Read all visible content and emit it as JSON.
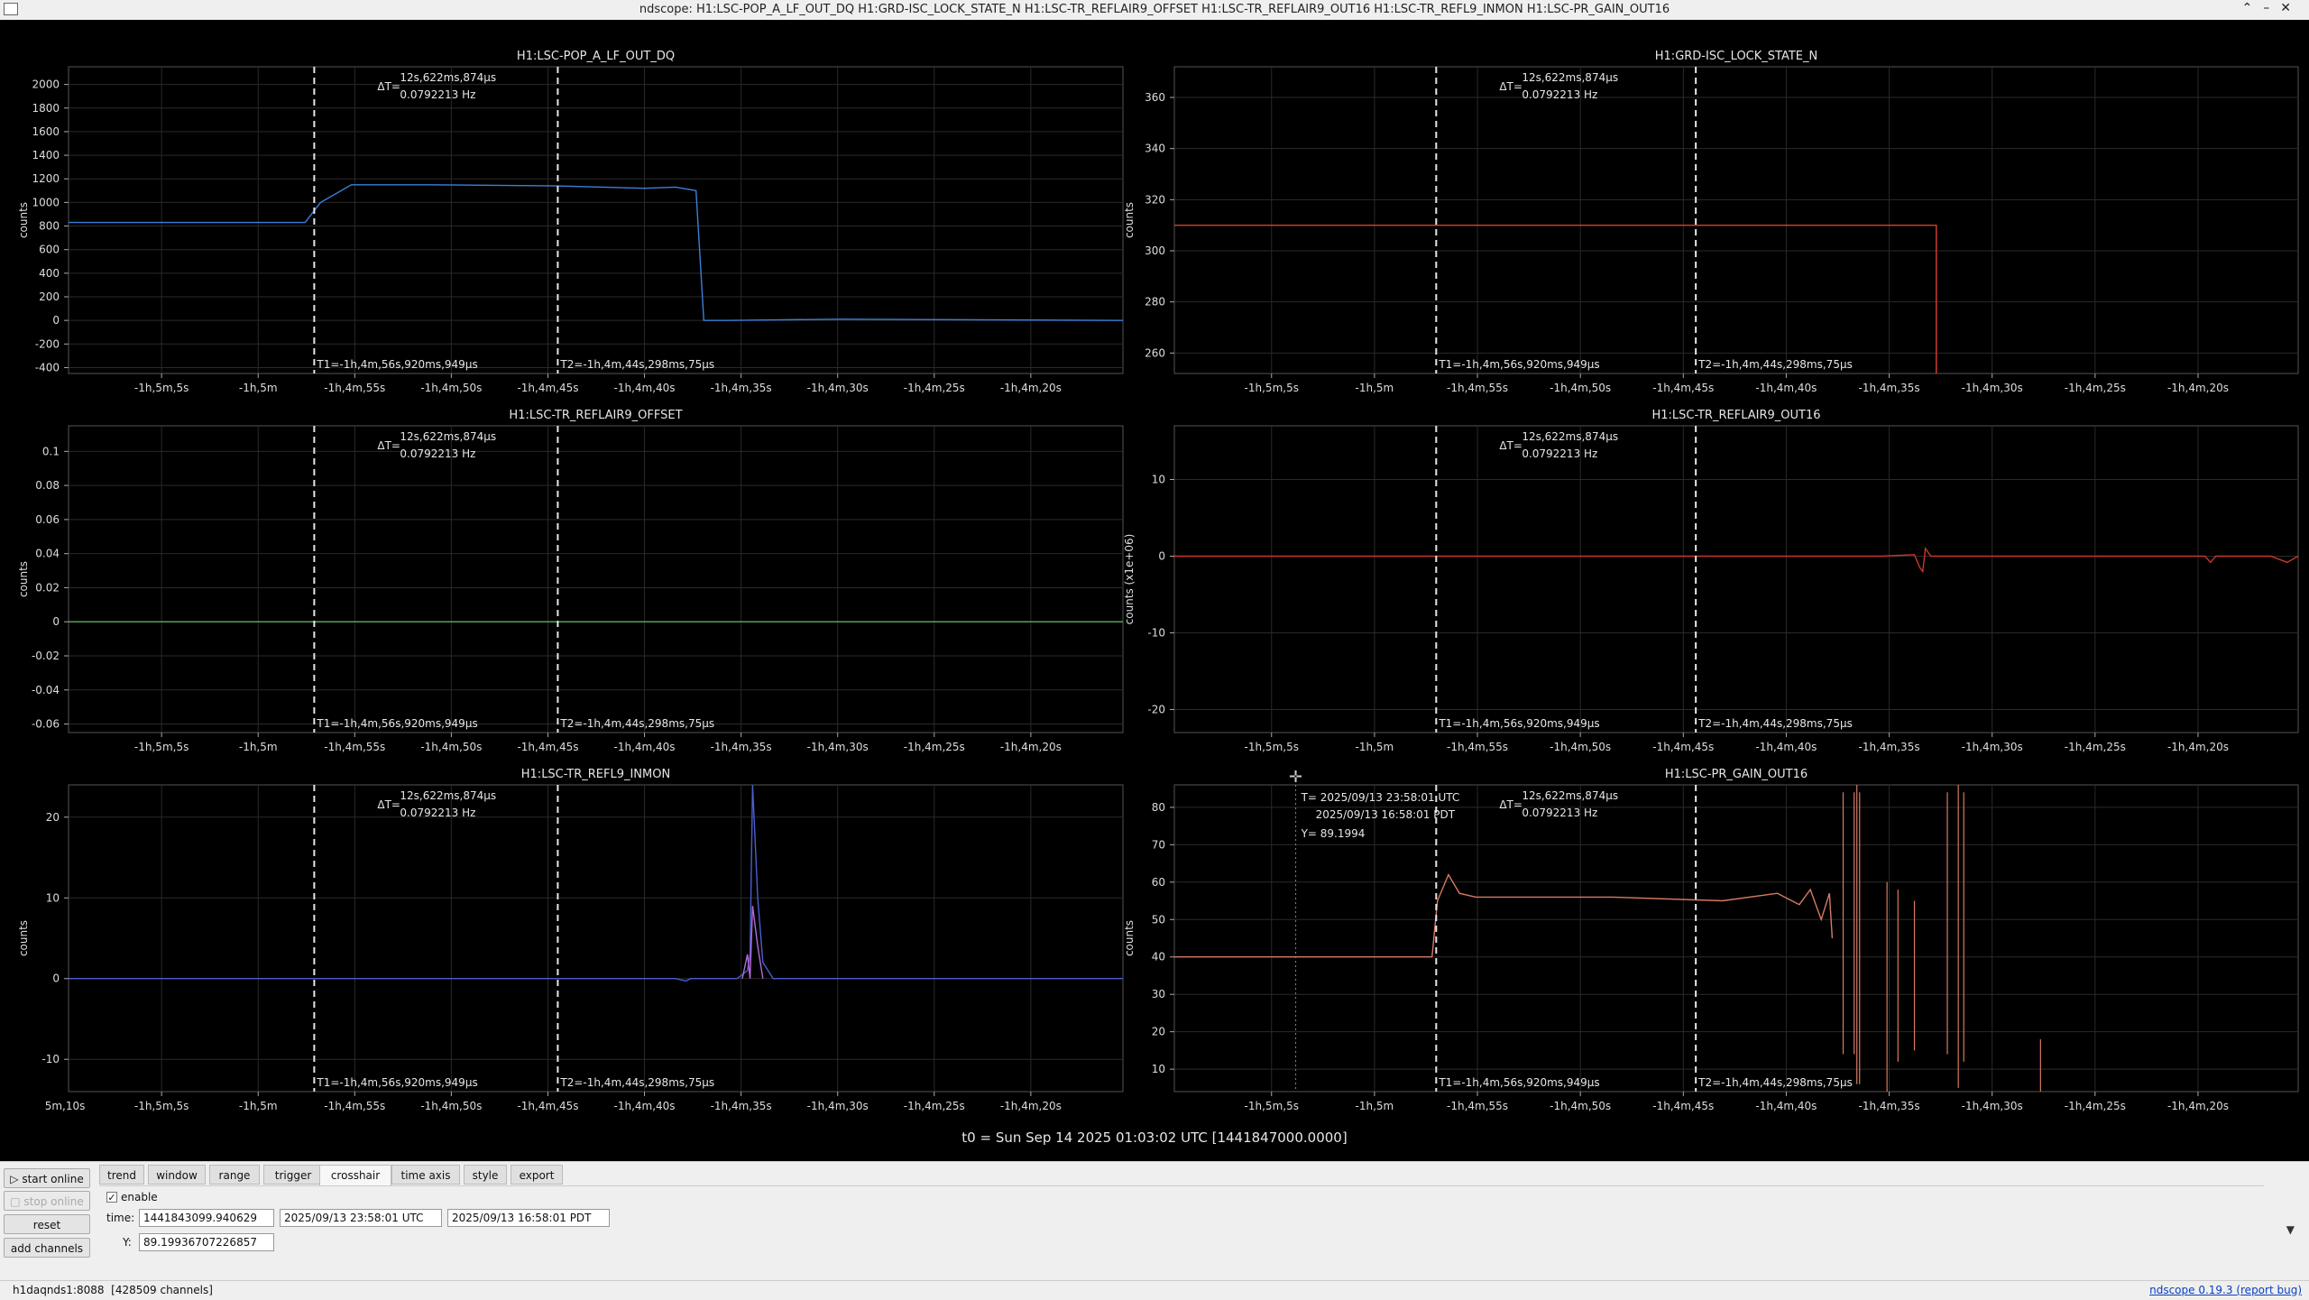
{
  "window": {
    "title": "ndscope: H1:LSC-POP_A_LF_OUT_DQ H1:GRD-ISC_LOCK_STATE_N H1:LSC-TR_REFLAIR9_OFFSET H1:LSC-TR_REFLAIR9_OUT16 H1:LSC-TR_REFL9_INMON H1:LSC-PR_GAIN_OUT16",
    "buttons": [
      "minimize",
      "maximize",
      "close"
    ]
  },
  "cursors": {
    "t1": "T1=-1h,4m,56s,920ms,949μs",
    "t2": "T2=-1h,4m,44s,298ms,75μs",
    "delta_label": "ΔT=",
    "delta_time": "12s,622ms,874μs",
    "delta_freq": "0.0792213 Hz"
  },
  "crosshair_readout": {
    "t_utc": "T= 2025/09/13 23:58:01 UTC",
    "t_pdt": "2025/09/13 16:58:01 PDT",
    "y": "Y= 89.1994"
  },
  "t0_label": "t0 = Sun Sep 14 2025 01:03:02 UTC [1441847000.0000]",
  "chart_data": [
    {
      "type": "line",
      "title": "H1:LSC-POP_A_LF_OUT_DQ",
      "ylabel": "counts",
      "ylim": [
        -450,
        2150
      ],
      "yticks": [
        -400,
        -200,
        0,
        200,
        400,
        600,
        800,
        1000,
        1200,
        1400,
        1600,
        1800,
        2000
      ],
      "xlim": [
        -65.4,
        -63.35
      ],
      "xticks": [
        "-1h,5m,5s",
        "-1h,5m",
        "-1h,4m,55s",
        "-1h,4m,50s",
        "-1h,4m,45s",
        "-1h,4m,40s",
        "-1h,4m,35s",
        "-1h,4m,30s",
        "-1h,4m,25s",
        "-1h,4m,20s"
      ],
      "series": [
        {
          "color": "#3d7fd8",
          "x": [
            -65.4,
            -64.94,
            -64.91,
            -64.85,
            -64.7,
            -64.45,
            -64.28,
            -64.22,
            -64.18,
            -64.165,
            -64.12,
            -63.9,
            -63.35
          ],
          "y": [
            830,
            830,
            1000,
            1150,
            1150,
            1140,
            1120,
            1130,
            1100,
            0,
            0,
            10,
            0
          ]
        }
      ]
    },
    {
      "type": "line",
      "title": "H1:GRD-ISC_LOCK_STATE_N",
      "ylabel": "counts",
      "ylim": [
        252,
        372
      ],
      "yticks": [
        260,
        280,
        300,
        320,
        340,
        360
      ],
      "xlim": [
        -65.4,
        -63.35
      ],
      "xticks": [
        "-1h,5m,5s",
        "-1h,5m",
        "-1h,4m,55s",
        "-1h,4m,50s",
        "-1h,4m,45s",
        "-1h,4m,40s",
        "-1h,4m,35s",
        "-1h,4m,30s",
        "-1h,4m,25s",
        "-1h,4m,20s"
      ],
      "series": [
        {
          "color": "#d9402a",
          "x": [
            -65.4,
            -64.01,
            -64.01
          ],
          "y": [
            310,
            310,
            252
          ]
        }
      ]
    },
    {
      "type": "line",
      "title": "H1:LSC-TR_REFLAIR9_OFFSET",
      "ylabel": "counts",
      "ylim": [
        -0.065,
        0.115
      ],
      "yticks": [
        -0.06,
        -0.04,
        -0.02,
        0,
        0.02,
        0.04,
        0.06,
        0.08,
        0.1
      ],
      "xlim": [
        -65.4,
        -63.35
      ],
      "xticks": [
        "-1h,5m,5s",
        "-1h,5m",
        "-1h,4m,55s",
        "-1h,4m,50s",
        "-1h,4m,45s",
        "-1h,4m,40s",
        "-1h,4m,35s",
        "-1h,4m,30s",
        "-1h,4m,25s",
        "-1h,4m,20s"
      ],
      "series": [
        {
          "color": "#5fae5f",
          "x": [
            -65.4,
            -63.35
          ],
          "y": [
            0,
            0
          ]
        }
      ]
    },
    {
      "type": "line",
      "title": "H1:LSC-TR_REFLAIR9_OUT16",
      "ylabel": "counts (x1e+06)",
      "ylim": [
        -23,
        17
      ],
      "yticks": [
        -20,
        -10,
        0,
        10
      ],
      "xlim": [
        -65.4,
        -63.35
      ],
      "xticks": [
        "-1h,5m,5s",
        "-1h,5m",
        "-1h,4m,55s",
        "-1h,4m,50s",
        "-1h,4m,45s",
        "-1h,4m,40s",
        "-1h,4m,35s",
        "-1h,4m,30s",
        "-1h,4m,25s",
        "-1h,4m,20s"
      ],
      "series": [
        {
          "color": "#c8372a",
          "x": [
            -65.4,
            -64.11,
            -64.05,
            -64.04,
            -64.035,
            -64.03,
            -64.02,
            -63.85,
            -63.52,
            -63.51,
            -63.5,
            -63.4,
            -63.37,
            -63.35
          ],
          "y": [
            0,
            0,
            0.2,
            -1.5,
            -2,
            1,
            0,
            0,
            0,
            -0.8,
            0,
            0,
            -0.8,
            0
          ]
        }
      ]
    },
    {
      "type": "line",
      "title": "H1:LSC-TR_REFL9_INMON",
      "ylabel": "counts",
      "ylim": [
        -14,
        24
      ],
      "yticks": [
        -10,
        0,
        10,
        20
      ],
      "xlim": [
        -65.4,
        -63.35
      ],
      "xticks": [
        "5m,10s",
        "-1h,5m,5s",
        "-1h,5m",
        "-1h,4m,55s",
        "-1h,4m,50s",
        "-1h,4m,45s",
        "-1h,4m,40s",
        "-1h,4m,35s",
        "-1h,4m,30s",
        "-1h,4m,25s",
        "-1h,4m,20s"
      ],
      "series": [
        {
          "color": "#4a5fd0",
          "x": [
            -65.4,
            -64.22,
            -64.2,
            -64.19,
            -64.1,
            -64.08,
            -64.075,
            -64.07,
            -64.06,
            -64.05,
            -64.03,
            -63.35
          ],
          "y": [
            0,
            0,
            -0.3,
            0,
            0,
            1,
            3,
            24,
            10,
            2,
            0,
            0
          ]
        },
        {
          "color": "#b56ad8",
          "x": [
            -64.09,
            -64.08,
            -64.075,
            -64.07,
            -64.06,
            -64.05
          ],
          "y": [
            0,
            3,
            0,
            9,
            4,
            0
          ]
        }
      ]
    },
    {
      "type": "line",
      "title": "H1:LSC-PR_GAIN_OUT16",
      "ylabel": "counts",
      "ylim": [
        4,
        86
      ],
      "yticks": [
        10,
        20,
        30,
        40,
        50,
        60,
        70,
        80
      ],
      "xlim": [
        -65.4,
        -63.35
      ],
      "xticks": [
        "-1h,5m,5s",
        "-1h,5m",
        "-1h,4m,55s",
        "-1h,4m,50s",
        "-1h,4m,45s",
        "-1h,4m,40s",
        "-1h,4m,35s",
        "-1h,4m,30s",
        "-1h,4m,25s",
        "-1h,4m,20s"
      ],
      "series": [
        {
          "color": "#d87a62",
          "x": [
            -65.4,
            -64.93,
            -64.92,
            -64.9,
            -64.88,
            -64.85,
            -64.6,
            -64.4,
            -64.3,
            -64.26,
            -64.24,
            -64.22,
            -64.205,
            -64.2
          ],
          "y": [
            40,
            40,
            55,
            62,
            57,
            56,
            56,
            55,
            57,
            54,
            58,
            50,
            57,
            45
          ]
        }
      ]
    }
  ],
  "tabs": [
    "trend",
    "window",
    "range",
    "trigger",
    "crosshair",
    "time axis",
    "style",
    "export"
  ],
  "active_tab": "crosshair",
  "left_buttons": {
    "start_online": "start online",
    "stop_online": "stop online",
    "reset": "reset",
    "add_channels": "add channels"
  },
  "crosshair_panel": {
    "enable_label": "enable",
    "enable_checked": true,
    "time_label": "time:",
    "time_gps": "1441843099.940629",
    "time_utc": "2025/09/13 23:58:01 UTC",
    "time_pdt": "2025/09/13 16:58:01 PDT",
    "y_label": "Y:",
    "y_value": "89.19936707226857"
  },
  "status": {
    "server": "h1daqnds1:8088",
    "channels": "[428509 channels]",
    "version_link": "ndscope 0.19.3",
    "report_bug": "(report bug)"
  }
}
